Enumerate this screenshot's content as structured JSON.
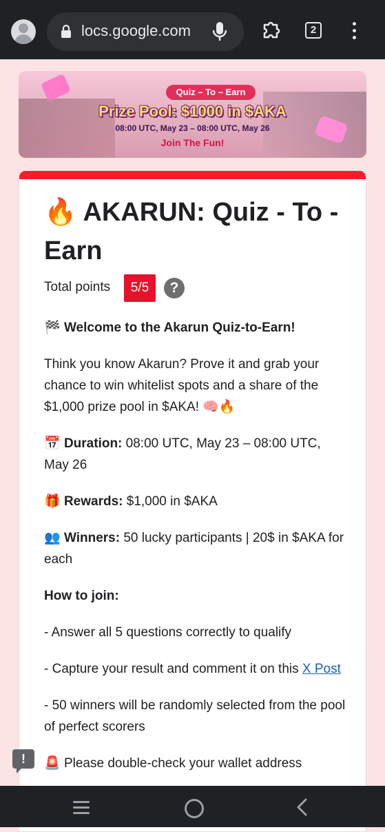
{
  "browser": {
    "url": "locs.google.com",
    "tab_count": "2"
  },
  "banner": {
    "pill": "Quiz – To – Earn",
    "prize": "Prize Pool: $1000 in $AKA",
    "dates": "08:00 UTC, May 23 – 08:00 UTC, May 26",
    "join": "Join The Fun!"
  },
  "form": {
    "title_emoji": "🔥",
    "title": "AKARUN: Quiz - To - Earn",
    "total_points_label": "Total points",
    "score": "5/5",
    "help": "?",
    "welcome_emoji": "🏁",
    "welcome": "Welcome to the Akarun Quiz-to-Earn!",
    "intro": "Think you know Akarun? Prove it and grab your chance to win whitelist spots and a share of the $1,000 prize pool in $AKA! 🧠🔥",
    "duration_emoji": "📅",
    "duration_label": "Duration:",
    "duration_value": "08:00 UTC, May 23 – 08:00 UTC, May 26",
    "rewards_emoji": "🎁",
    "rewards_label": "Rewards:",
    "rewards_value": "$1,000 in $AKA",
    "winners_emoji": "👥",
    "winners_label": "Winners:",
    "winners_value": "50 lucky participants | 20$ in $AKA for each",
    "how_to_join": "How to join:",
    "step1": "- Answer all 5 questions correctly to qualify",
    "step2": "- Capture your result and comment it on this",
    "step2_link": "X Post",
    "step3": "- 50 winners will be randomly selected from the pool of perfect scorers",
    "warning_emoji": "🚨",
    "warning": "Please double-check your wallet address"
  },
  "report_icon": "!"
}
